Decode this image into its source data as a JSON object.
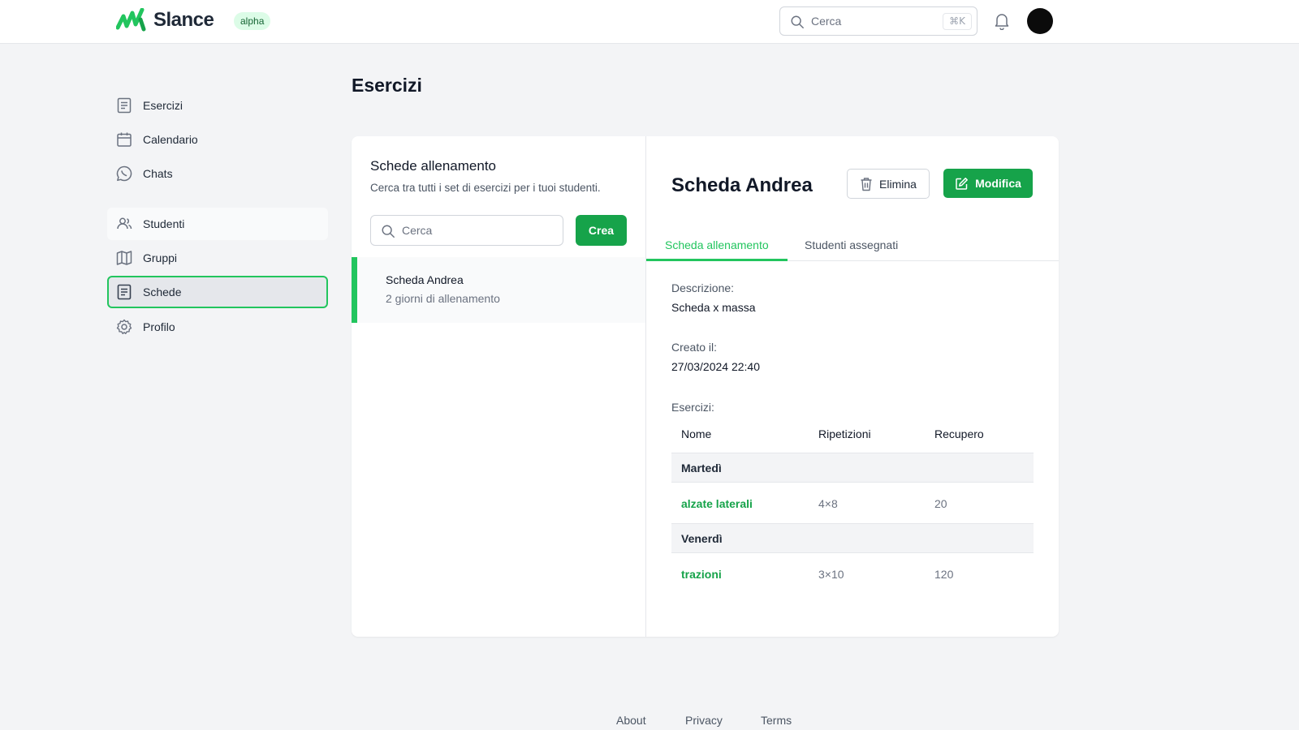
{
  "header": {
    "brand": "Slance",
    "badge": "alpha",
    "search_placeholder": "Cerca",
    "shortcut": "⌘K",
    "colors": {
      "brand_green": "#22c55e",
      "primary": "#16a34a"
    }
  },
  "sidebar": {
    "items": [
      {
        "label": "Esercizi",
        "icon": "document-icon"
      },
      {
        "label": "Calendario",
        "icon": "calendar-icon"
      },
      {
        "label": "Chats",
        "icon": "whatsapp-icon"
      },
      {
        "label": "Studenti",
        "icon": "users-icon"
      },
      {
        "label": "Gruppi",
        "icon": "map-icon"
      },
      {
        "label": "Schede",
        "icon": "document-icon",
        "active": true
      },
      {
        "label": "Profilo",
        "icon": "gear-icon"
      }
    ]
  },
  "page": {
    "title": "Esercizi"
  },
  "list_panel": {
    "title": "Schede allenamento",
    "subtitle": "Cerca tra tutti i set di esercizi per i tuoi studenti.",
    "search_placeholder": "Cerca",
    "create_label": "Crea",
    "items": [
      {
        "name": "Scheda Andrea",
        "info": "2 giorni di allenamento",
        "selected": true
      }
    ]
  },
  "detail": {
    "title": "Scheda Andrea",
    "delete_label": "Elimina",
    "edit_label": "Modifica",
    "tabs": [
      {
        "label": "Scheda allenamento",
        "active": true
      },
      {
        "label": "Studenti assegnati",
        "active": false
      }
    ],
    "description_label": "Descrizione:",
    "description": "Scheda x massa",
    "created_label": "Creato il:",
    "created": "27/03/2024 22:40",
    "exercises_label": "Esercizi:",
    "table": {
      "columns": [
        "Nome",
        "Ripetizioni",
        "Recupero"
      ],
      "groups": [
        {
          "day": "Martedì",
          "rows": [
            {
              "name": "alzate laterali",
              "reps": "4×8",
              "rest": "20"
            }
          ]
        },
        {
          "day": "Venerdì",
          "rows": [
            {
              "name": "trazioni",
              "reps": "3×10",
              "rest": "120"
            }
          ]
        }
      ]
    }
  },
  "footer": {
    "links": [
      "About",
      "Privacy",
      "Terms"
    ]
  }
}
